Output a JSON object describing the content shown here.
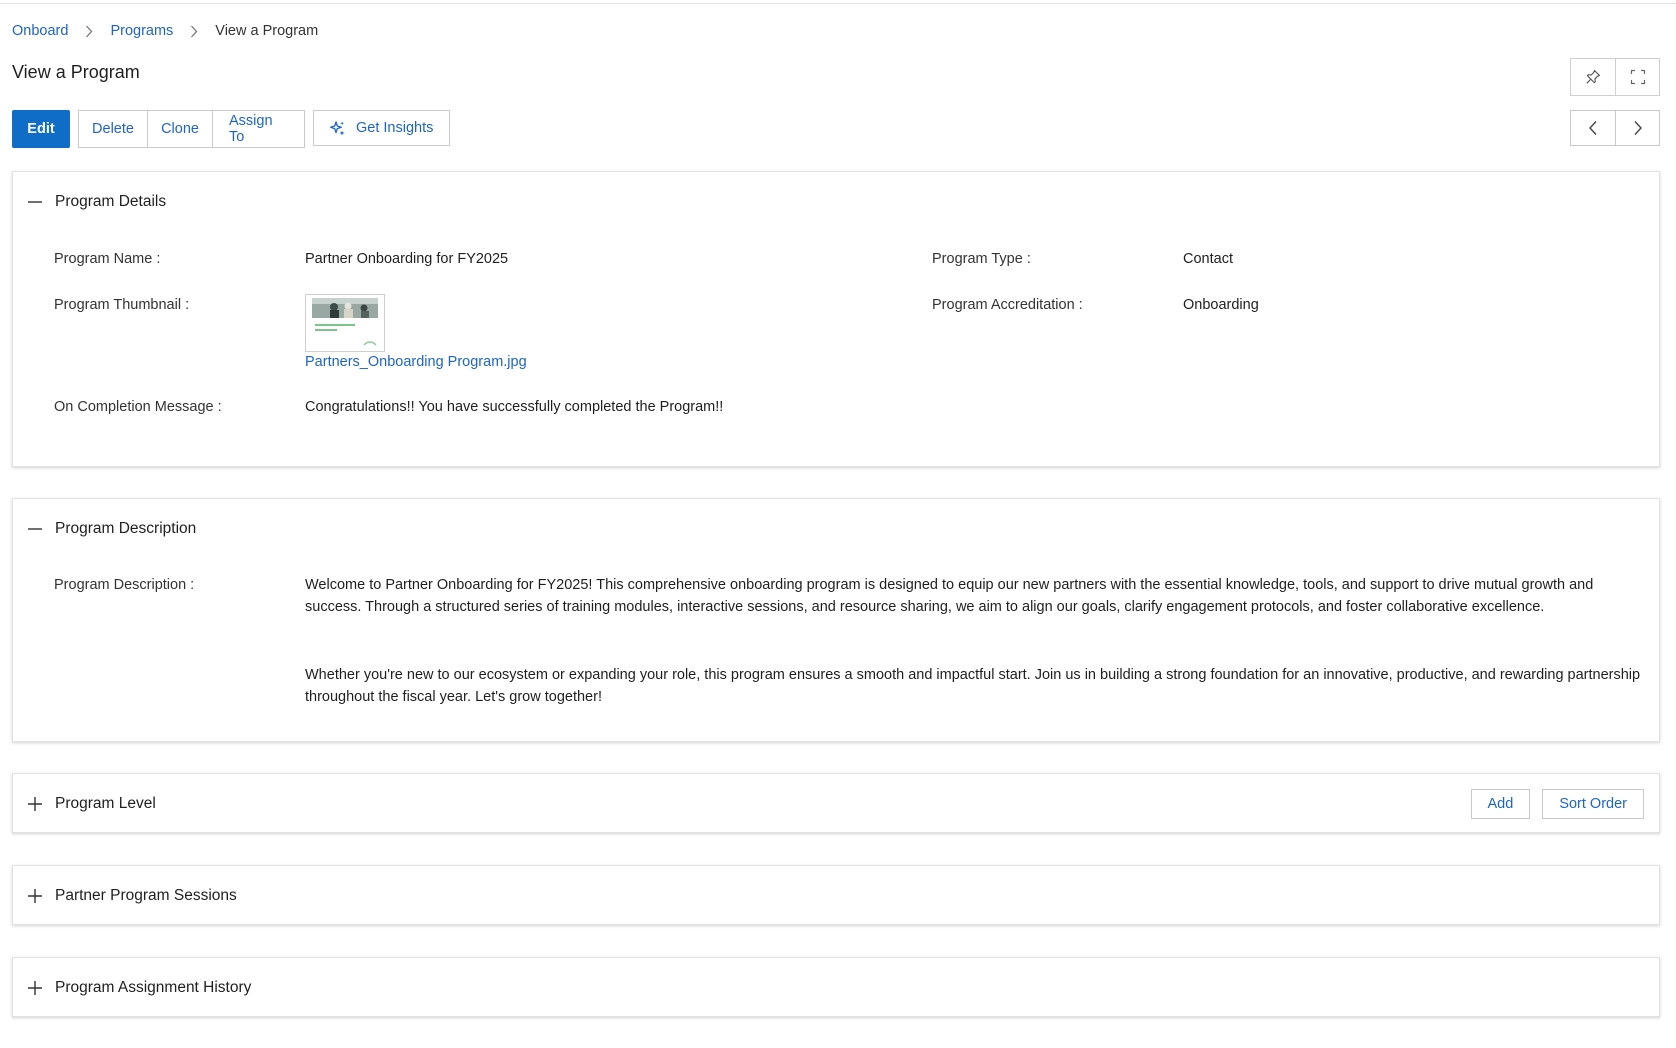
{
  "breadcrumb": {
    "items": [
      {
        "label": "Onboard"
      },
      {
        "label": "Programs"
      },
      {
        "label": "View a Program"
      }
    ]
  },
  "page": {
    "title": "View a Program"
  },
  "toolbar": {
    "edit_label": "Edit",
    "delete_label": "Delete",
    "clone_label": "Clone",
    "assign_label": "Assign To",
    "insights_label": "Get Insights"
  },
  "icons": {
    "pin": "pin-icon",
    "fullscreen": "fullscreen-icon",
    "prev": "chevron-left-icon",
    "next": "chevron-right-icon",
    "sparkle": "sparkle-icon",
    "collapse": "minus-icon",
    "expand": "plus-icon"
  },
  "colors": {
    "primary": "#0f6cc7",
    "link": "#1e64c8"
  },
  "program_details": {
    "title": "Program Details",
    "name_label": "Program Name :",
    "name_value": "Partner Onboarding for FY2025",
    "thumbnail_label": "Program Thumbnail :",
    "thumbnail_file": "Partners_Onboarding Program.jpg",
    "thumbnail_caption": "Partner Onboarding Program",
    "completion_label": "On Completion Message :",
    "completion_value": "Congratulations!! You have successfully completed the Program!!",
    "type_label": "Program Type :",
    "type_value": "Contact",
    "accreditation_label": "Program Accreditation :",
    "accreditation_value": "Onboarding"
  },
  "program_description": {
    "title": "Program Description",
    "label": "Program Description :",
    "paragraph1": "Welcome to Partner Onboarding for FY2025! This comprehensive onboarding program is designed to equip our new partners with the essential knowledge, tools, and support to drive mutual growth and success. Through a structured series of training modules, interactive sessions, and resource sharing, we aim to align our goals, clarify engagement protocols, and foster collaborative excellence.",
    "paragraph2": "Whether you're new to our ecosystem or expanding your role, this program ensures a smooth and impactful start. Join us in building a strong foundation for an innovative, productive, and rewarding partnership throughout the fiscal year. Let's grow together!"
  },
  "program_level": {
    "title": "Program Level",
    "add_label": "Add",
    "sort_label": "Sort Order"
  },
  "sessions": {
    "title": "Partner Program Sessions"
  },
  "assignment_history": {
    "title": "Program Assignment History"
  }
}
